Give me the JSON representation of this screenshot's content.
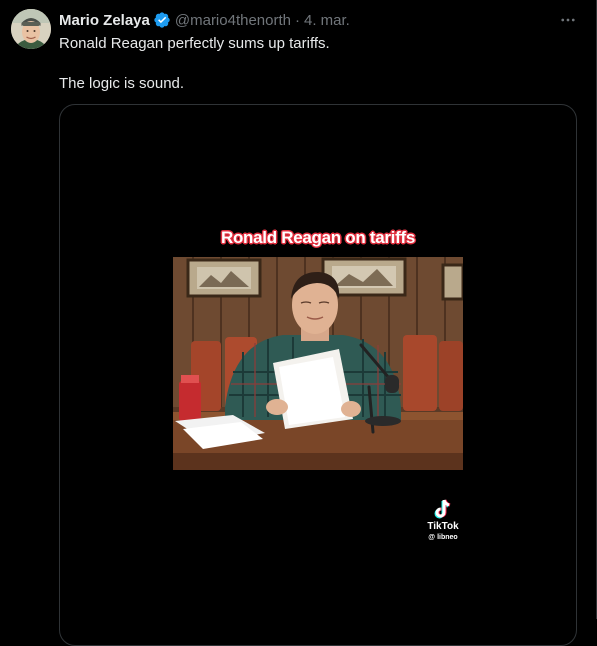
{
  "tweet": {
    "display_name": "Mario Zelaya",
    "handle": "@mario4thenorth",
    "separator": "·",
    "date": "4. mar.",
    "more_icon": "more-horizontal-icon",
    "verified_icon": "verified-badge-icon",
    "text_lines": [
      "Ronald Reagan perfectly sums up tariffs.",
      "The logic is sound."
    ]
  },
  "media": {
    "caption": "Ronald Reagan on tariffs",
    "watermark": {
      "brand": "TikTok",
      "user": "@ libneo",
      "icon": "tiktok-logo-icon"
    }
  },
  "colors": {
    "background": "#000000",
    "text": "#e7e9ea",
    "muted": "#71767b",
    "border": "#2f3336",
    "verified": "#1d9bf0",
    "caption_outline": "#e02e3e"
  }
}
